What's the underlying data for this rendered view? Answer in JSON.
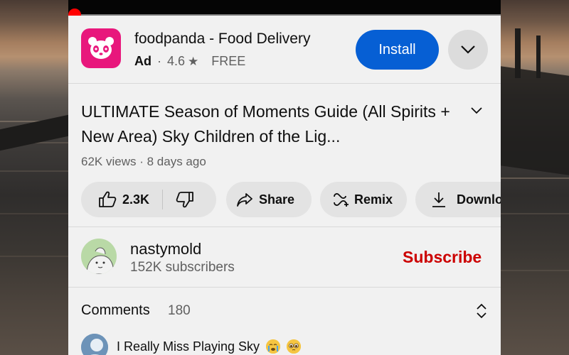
{
  "ad": {
    "app_name": "foodpanda - Food Delivery",
    "badge": "Ad",
    "rating": "4.6",
    "price": "FREE",
    "install_label": "Install",
    "brand_color": "#e8177c",
    "install_color": "#065fd4"
  },
  "video": {
    "title": "ULTIMATE Season of Moments Guide (All Spirits + New Area) Sky Children of the Lig...",
    "views": "62K views",
    "age": "8 days ago"
  },
  "actions": {
    "likes": "2.3K",
    "share": "Share",
    "remix": "Remix",
    "download": "Download"
  },
  "channel": {
    "name": "nastymold",
    "subscribers": "152K subscribers",
    "subscribe_label": "Subscribe",
    "subscribe_color": "#cc0000"
  },
  "comments": {
    "label": "Comments",
    "count": "180",
    "top_comment": "I Really Miss Playing Sky"
  },
  "icons": [
    "panda-logo-icon",
    "chevron-down-icon",
    "thumbs-up-icon",
    "thumbs-down-icon",
    "share-arrow-icon",
    "remix-icon",
    "download-icon",
    "expand-icon",
    "crying-emoji",
    "pleading-emoji"
  ]
}
